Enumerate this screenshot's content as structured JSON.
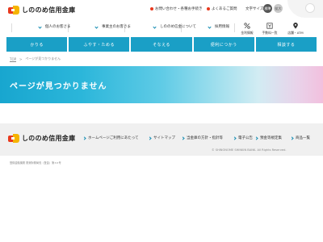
{
  "header": {
    "logo_text": "しののめ信用金庫",
    "utility": {
      "contact": "お問い合わせ・各種お手続き",
      "faq": "よくあるご質問",
      "text_size": "文字サイズ",
      "size_standard": "標準",
      "size_large": "拡大"
    }
  },
  "nav_primary": [
    "個人のお客さま",
    "事業主のお客さま",
    "しののめ信金について",
    "採用情報"
  ],
  "nav_icons": [
    {
      "label": "金利情報",
      "icon": "percent-icon"
    },
    {
      "label": "手数料一覧",
      "icon": "yen-icon"
    },
    {
      "label": "店舗・ATM",
      "icon": "map-pin-icon"
    }
  ],
  "nav_secondary": [
    "かりる",
    "ふやす・ためる",
    "そなえる",
    "便利につかう",
    "相談する"
  ],
  "breadcrumb": {
    "home": "TOP",
    "separator": ">",
    "current": "ページが見つかりません"
  },
  "hero": {
    "title": "ページが見つかりません"
  },
  "footer": {
    "logo_text": "しののめ信用金庫",
    "links": [
      "ホームページご利用にあたって",
      "サイトマップ",
      "当金庫の方針・指針等",
      "電子公告",
      "預金等規定集",
      "商品一覧"
    ],
    "copyright": "© SHINONOME SHINKIN BANK. All Rights Reserved."
  },
  "registration_note": "登録金融機関 関東財務局長（登金）第××号",
  "colors": {
    "accent": "#1a9fc6",
    "logo_red": "#e8391d",
    "logo_yellow": "#f5b400"
  }
}
